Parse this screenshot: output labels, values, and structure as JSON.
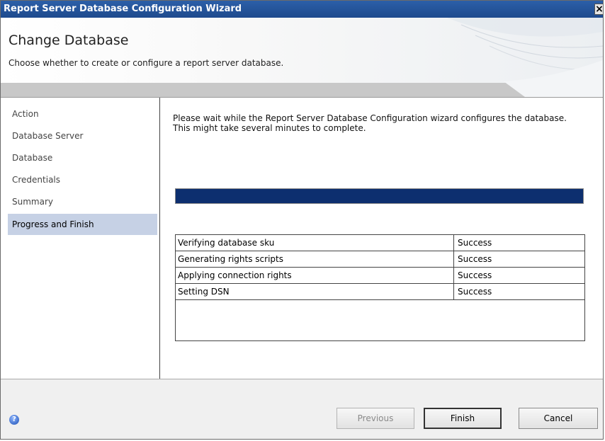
{
  "window": {
    "title": "Report Server Database Configuration Wizard",
    "close_label": "×"
  },
  "header": {
    "title": "Change Database",
    "subtitle": "Choose whether to create or configure a report server database."
  },
  "nav": {
    "items": [
      {
        "label": "Action"
      },
      {
        "label": "Database Server"
      },
      {
        "label": "Database"
      },
      {
        "label": "Credentials"
      },
      {
        "label": "Summary"
      },
      {
        "label": "Progress and Finish"
      }
    ],
    "active_index": 5
  },
  "main": {
    "message": "Please wait while the Report Server Database Configuration wizard configures the database.  This might take several minutes to complete.",
    "progress": {
      "value_percent": 100,
      "color": "#0d2f6f"
    },
    "steps": [
      {
        "name": "Verifying database sku",
        "status": "Success"
      },
      {
        "name": "Generating rights scripts",
        "status": "Success"
      },
      {
        "name": "Applying connection rights",
        "status": "Success"
      },
      {
        "name": "Setting DSN",
        "status": "Success"
      }
    ]
  },
  "footer": {
    "help_icon": "help-icon",
    "previous_label": "Previous",
    "finish_label": "Finish",
    "cancel_label": "Cancel"
  },
  "colors": {
    "titlebar": "#1e4a8d",
    "nav_active": "#c6d1e5"
  }
}
